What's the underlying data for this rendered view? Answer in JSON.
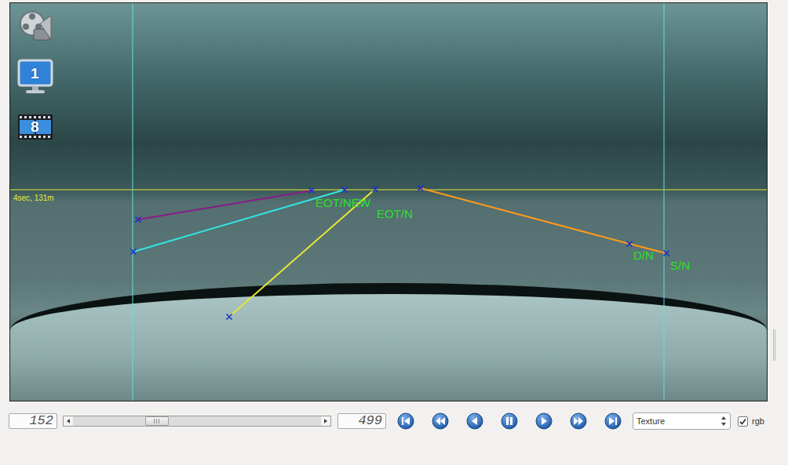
{
  "toolbar": {
    "tools": [
      {
        "kind": "reel"
      },
      {
        "kind": "monitor",
        "text": "1"
      },
      {
        "kind": "filmstrip",
        "text": "8"
      }
    ]
  },
  "overlay": {
    "info": "4sec, 131m",
    "lines": [
      {
        "color": "#8b1a8b"
      },
      {
        "color": "#33e6e6"
      },
      {
        "color": "#e6e633"
      },
      {
        "color": "#ff9a1a"
      }
    ],
    "labels": [
      "EOT/NEW",
      "EOT/N",
      "D/N",
      "S/N"
    ]
  },
  "controls": {
    "frame": "152",
    "slider": {
      "level": 0.32
    },
    "total": "499",
    "buttons": [
      {
        "kind": "first"
      },
      {
        "kind": "rewind"
      },
      {
        "kind": "prev"
      },
      {
        "kind": "pause"
      },
      {
        "kind": "play"
      },
      {
        "kind": "forward"
      },
      {
        "kind": "last"
      }
    ],
    "mode": "Texture",
    "rgb": {
      "label": "rgb",
      "checked": true
    }
  }
}
